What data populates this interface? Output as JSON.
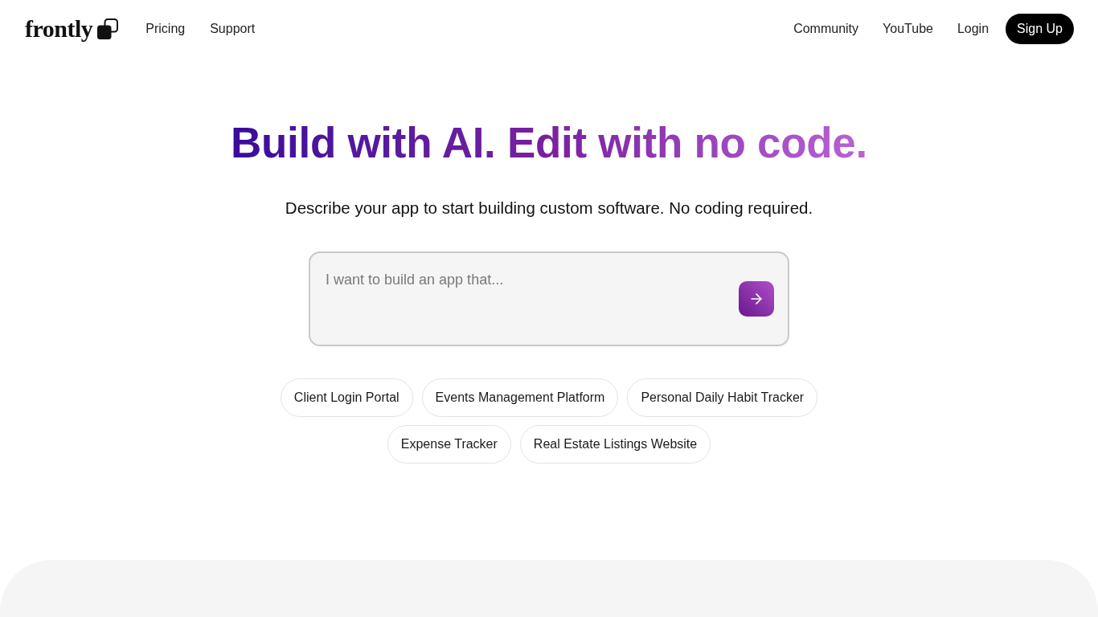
{
  "nav": {
    "logo": "frontly",
    "left_links": [
      "Pricing",
      "Support"
    ],
    "right_links": [
      "Community",
      "YouTube",
      "Login"
    ],
    "signup_button": "Sign Up"
  },
  "hero": {
    "headline": "Build with AI. Edit with no code.",
    "subtitle": "Describe your app to start building custom software. No coding required.",
    "prompt": {
      "placeholder": "I want to build an app that..."
    },
    "suggestion_rows": [
      [
        "Client Login Portal",
        "Events Management Platform",
        "Personal Daily Habit Tracker"
      ],
      [
        "Expense Tracker",
        "Real Estate Listings Website"
      ]
    ]
  }
}
